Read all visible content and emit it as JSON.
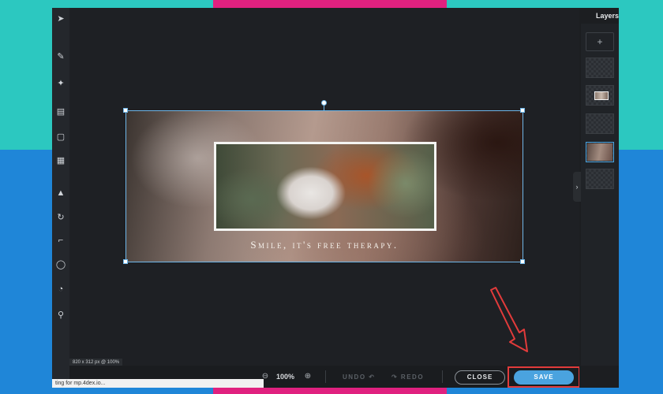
{
  "colors": {
    "frame_teal": "#2cc8c0",
    "frame_pink": "#e0217f",
    "frame_blue": "#1f86d8",
    "accent_save": "#4aa3df",
    "highlight_red": "#e23b3b"
  },
  "toolbar": {
    "tools": [
      {
        "name": "select-tool-icon",
        "glyph": "➤"
      },
      {
        "name": "brush-tool-icon",
        "glyph": "✎"
      },
      {
        "name": "star-tool-icon",
        "glyph": "✦"
      },
      {
        "name": "layers-tool-icon",
        "glyph": "▤"
      },
      {
        "name": "frame-tool-icon",
        "glyph": "▢"
      },
      {
        "name": "grid-tool-icon",
        "glyph": "▦"
      },
      {
        "name": "drop-tool-icon",
        "glyph": "▲"
      },
      {
        "name": "rotate-tool-icon",
        "glyph": "↻"
      },
      {
        "name": "crop-tool-icon",
        "glyph": "⌐"
      },
      {
        "name": "circle-tool-icon",
        "glyph": "◯"
      },
      {
        "name": "clock-tool-icon",
        "glyph": "◔"
      },
      {
        "name": "pin-tool-icon",
        "glyph": "⚲"
      }
    ]
  },
  "canvas": {
    "caption": "Smile, it's free therapy.",
    "size_label": "820 x 312 px @ 100%"
  },
  "bottombar": {
    "zoom_out_glyph": "⊖",
    "zoom_level": "100%",
    "zoom_in_glyph": "⊕",
    "undo_label": "UNDO ↶",
    "redo_label": "↷ REDO",
    "close_label": "CLOSE",
    "save_label": "SAVE"
  },
  "status_bar": {
    "text": "ting for mp.4dex.io..."
  },
  "layers_panel": {
    "title": "Layers",
    "add_glyph": "+",
    "toggle_glyph": "›"
  }
}
